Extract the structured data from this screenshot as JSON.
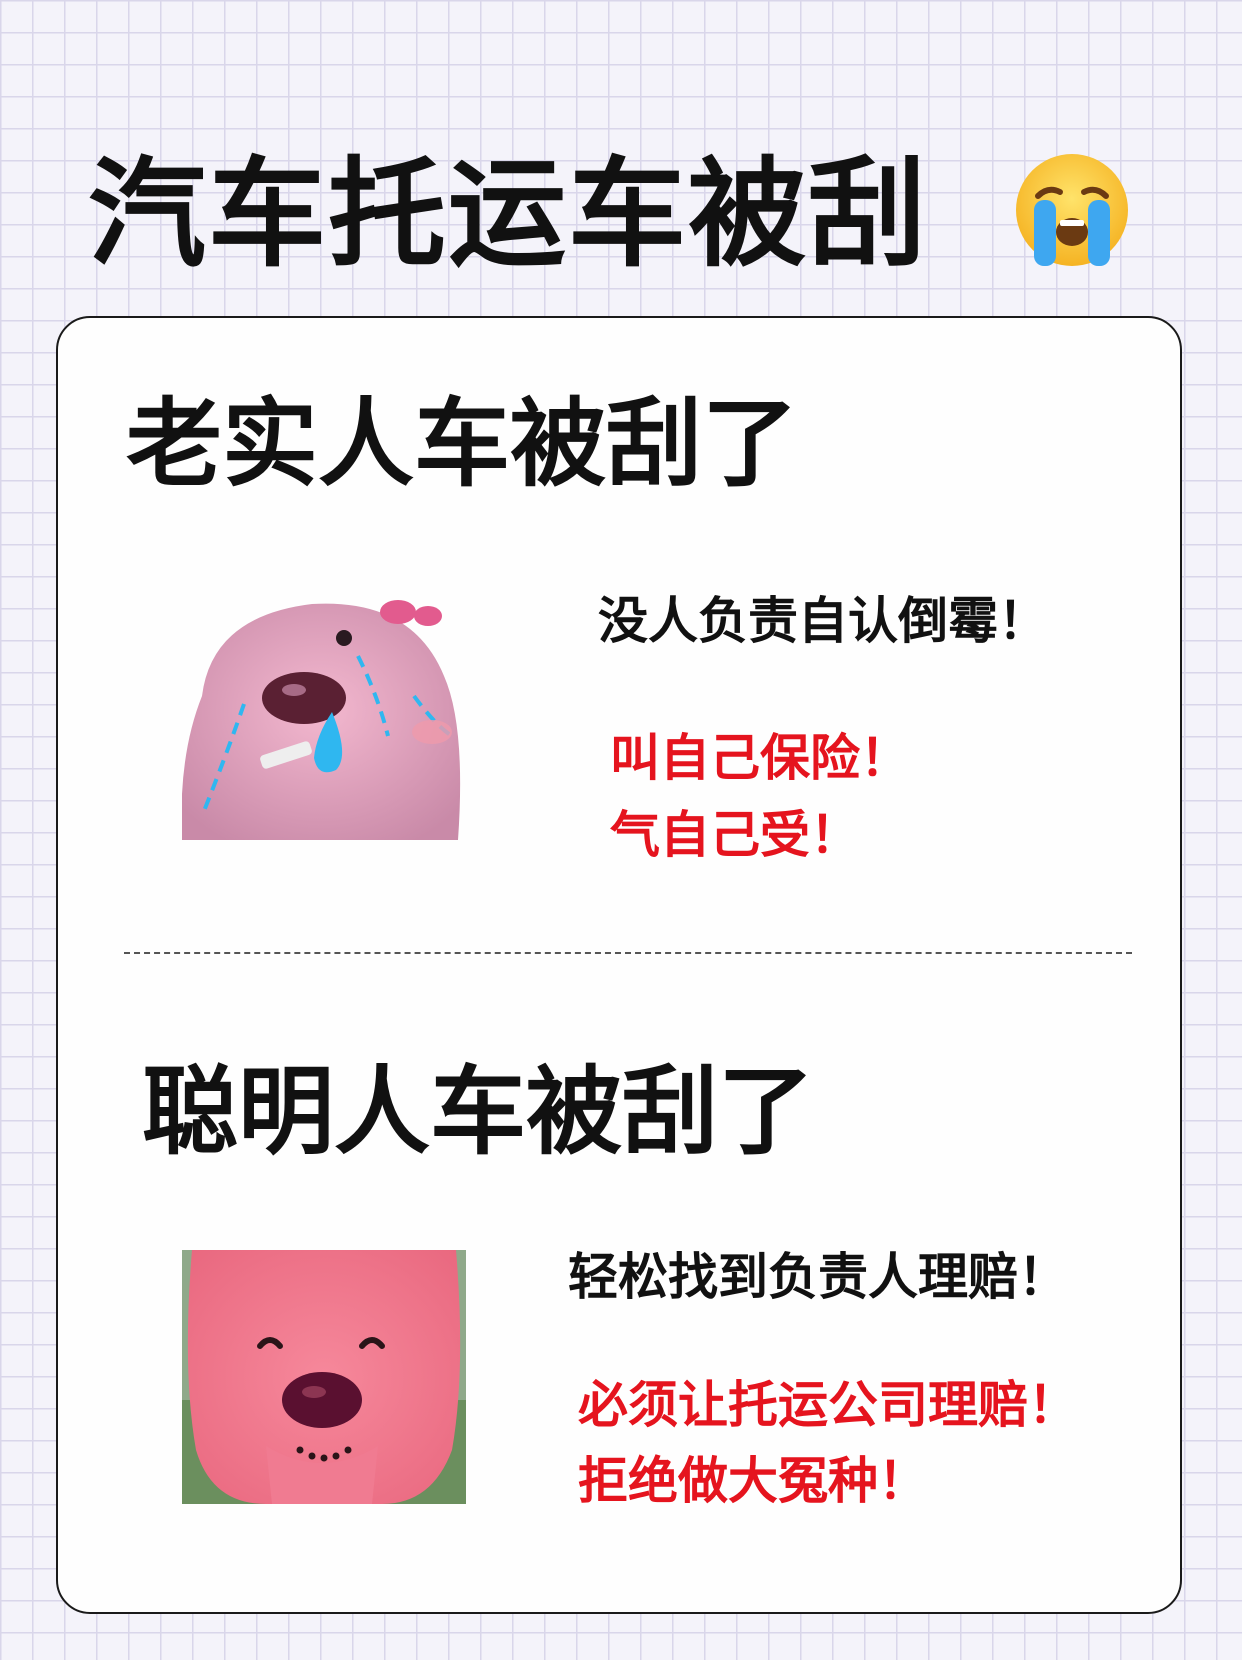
{
  "title": "汽车托运车被刮",
  "title_emoji": "loudly-crying-face-icon",
  "sections": [
    {
      "heading": "老实人车被刮了",
      "mascot": "crying-pink-beaver-smoking-icon",
      "line": "没人负责自认倒霉！",
      "red_lines": [
        "叫自己保险！",
        "气自己受！"
      ]
    },
    {
      "heading": "聪明人车被刮了",
      "mascot": "smiling-pink-beaver-icon",
      "line": "轻松找到负责人理赔！",
      "red_lines": [
        "必须让托运公司理赔！",
        "拒绝做大冤种！"
      ]
    }
  ],
  "colors": {
    "accent_red": "#e5141e",
    "text": "#111111",
    "background": "#f4f3fa",
    "grid": "#d9d6ea",
    "mascot_pink": "#e8a0bd"
  }
}
